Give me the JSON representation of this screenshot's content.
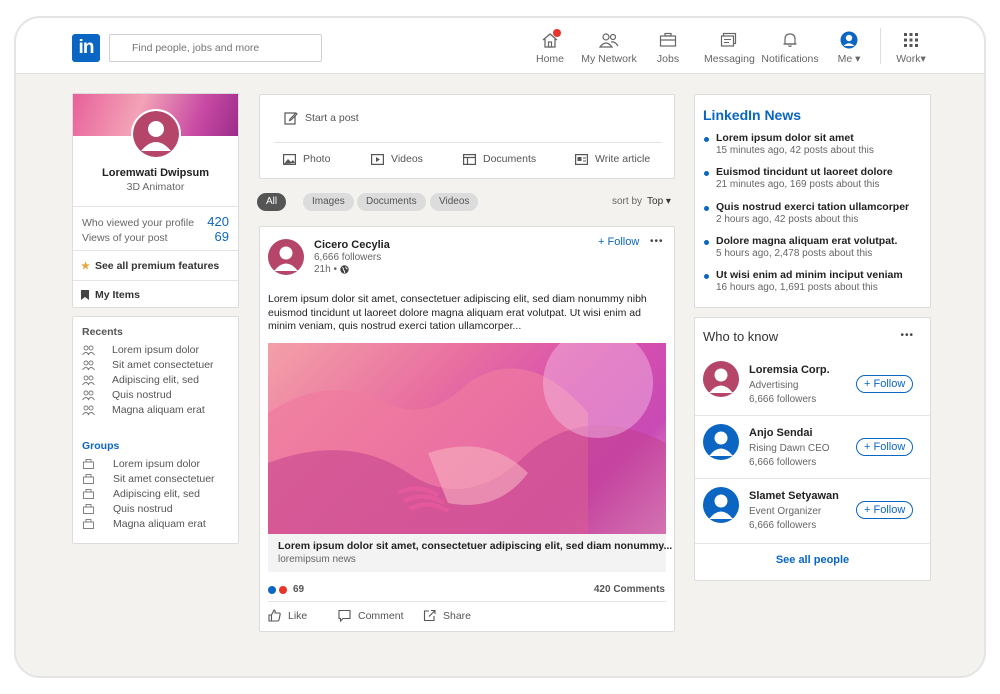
{
  "colors": {
    "accent": "#0a66c2",
    "badge": "#e8352a",
    "avatar": "#b5466a"
  },
  "header": {
    "logo": "in",
    "search_placeholder": "Find people, jobs and more",
    "nav": [
      {
        "label": "Home",
        "icon": "home-icon"
      },
      {
        "label": "My Network",
        "icon": "network-icon"
      },
      {
        "label": "Jobs",
        "icon": "briefcase-icon"
      },
      {
        "label": "Messaging",
        "icon": "messaging-icon"
      },
      {
        "label": "Notifications",
        "icon": "bell-icon"
      },
      {
        "label": "Me ▾",
        "icon": "profile-icon"
      },
      {
        "label": "Work▾",
        "icon": "grid-icon"
      }
    ]
  },
  "profile": {
    "name": "Loremwati Dwipsum",
    "title": "3D Animator",
    "viewed_label": "Who viewed your profile",
    "viewed_count": "420",
    "views_label": "Views of your post",
    "views_count": "69",
    "premium": "See all premium features",
    "my_items": "My Items"
  },
  "recents": {
    "heading": "Recents",
    "items": [
      "Lorem ipsum dolor",
      "Sit amet consectetuer",
      "Adipiscing elit, sed",
      "Quis nostrud",
      "Magna aliquam erat"
    ]
  },
  "groups": {
    "heading": "Groups",
    "items": [
      "Lorem ipsum dolor",
      "Sit amet consectetuer",
      "Adipiscing elit, sed",
      "Quis nostrud",
      "Magna aliquam erat"
    ]
  },
  "composer": {
    "start": "Start a post",
    "actions": [
      "Photo",
      "Videos",
      "Documents",
      "Write article"
    ]
  },
  "filters": {
    "pills": [
      "All",
      "Images",
      "Documents",
      "Videos"
    ],
    "sort_label": "sort by",
    "sort_value": "Top ▾"
  },
  "post": {
    "author": "Cicero Cecylia",
    "followers": "6,666 followers",
    "time": "21h •",
    "follow": "+ Follow",
    "more": "•••",
    "body": "Lorem ipsum dolor sit amet, consectetuer adipiscing elit, sed diam nonummy nibh euismod tincidunt ut laoreet dolore magna aliquam erat volutpat. Ut wisi enim ad minim veniam, quis nostrud exerci tation ullamcorper...",
    "link_title": "Lorem ipsum dolor sit amet, consectetuer adipiscing elit, sed diam nonummy...",
    "link_source": "loremipsum news",
    "reactions": "69",
    "comments": "420 Comments",
    "actions": [
      "Like",
      "Comment",
      "Share"
    ]
  },
  "news": {
    "heading": "LinkedIn News",
    "items": [
      {
        "title": "Lorem ipsum dolor sit amet",
        "meta": "15 minutes ago, 42 posts about this"
      },
      {
        "title": "Euismod tincidunt ut laoreet dolore",
        "meta": "21 minutes ago, 169 posts about this"
      },
      {
        "title": "Quis nostrud exerci tation ullamcorper",
        "meta": "2 hours ago, 42 posts about this"
      },
      {
        "title": "Dolore magna aliquam erat volutpat.",
        "meta": "5 hours ago, 2,478 posts about this"
      },
      {
        "title": "Ut wisi enim ad minim inciput veniam",
        "meta": "16 hours ago, 1,691 posts about this"
      }
    ]
  },
  "who": {
    "heading": "Who to know",
    "more": "•••",
    "people": [
      {
        "name": "Loremsia Corp.",
        "role": "Advertising",
        "followers": "6,666 followers",
        "follow": "+ Follow",
        "avatar_color": "#b5466a"
      },
      {
        "name": "Anjo Sendai",
        "role": "Rising Dawn CEO",
        "followers": "6,666 followers",
        "follow": "+ Follow",
        "avatar_color": "#0a66c2"
      },
      {
        "name": "Slamet Setyawan",
        "role": "Event Organizer",
        "followers": "6,666 followers",
        "follow": "+ Follow",
        "avatar_color": "#0a66c2"
      }
    ],
    "see_all": "See all people"
  }
}
